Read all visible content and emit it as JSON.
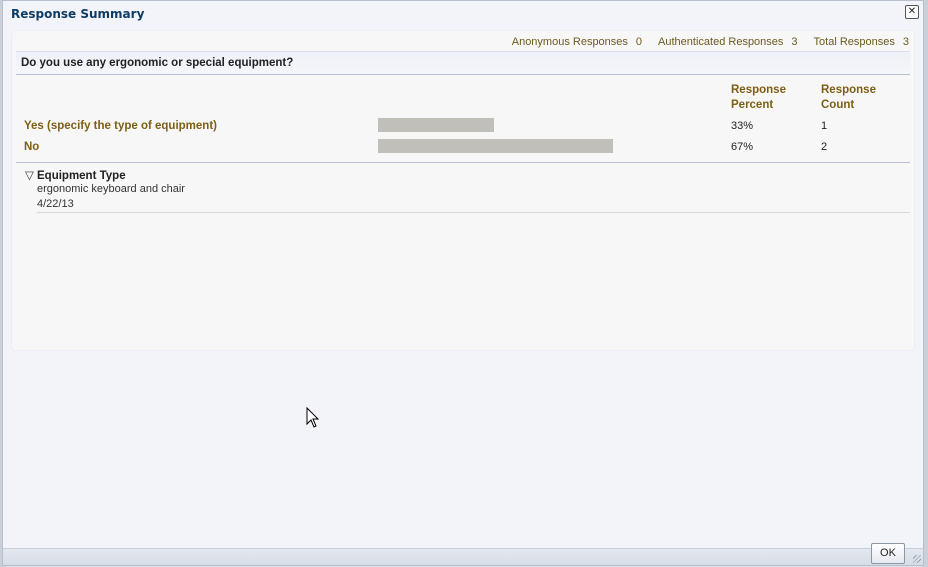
{
  "dialog": {
    "title": "Response Summary",
    "close_label": "✕"
  },
  "stats": {
    "anonymous_label": "Anonymous Responses",
    "anonymous_value": "0",
    "authenticated_label": "Authenticated Responses",
    "authenticated_value": "3",
    "total_label": "Total Responses",
    "total_value": "3"
  },
  "question": "Do you use any ergonomic or special equipment?",
  "columns": {
    "percent": "Response Percent",
    "count": "Response Count"
  },
  "answers": [
    {
      "label": "Yes (specify the type of equipment)",
      "percent": "33%",
      "count": "1",
      "fraction": 0.33
    },
    {
      "label": "No",
      "percent": "67%",
      "count": "2",
      "fraction": 0.67
    }
  ],
  "detail": {
    "title": "Equipment Type",
    "response": "ergonomic keyboard and chair",
    "date": "4/22/13"
  },
  "footer": {
    "ok_label": "OK"
  },
  "colors": {
    "accent": "#7d5f14",
    "title": "#0e3c64",
    "bar": "#c0bfba"
  }
}
